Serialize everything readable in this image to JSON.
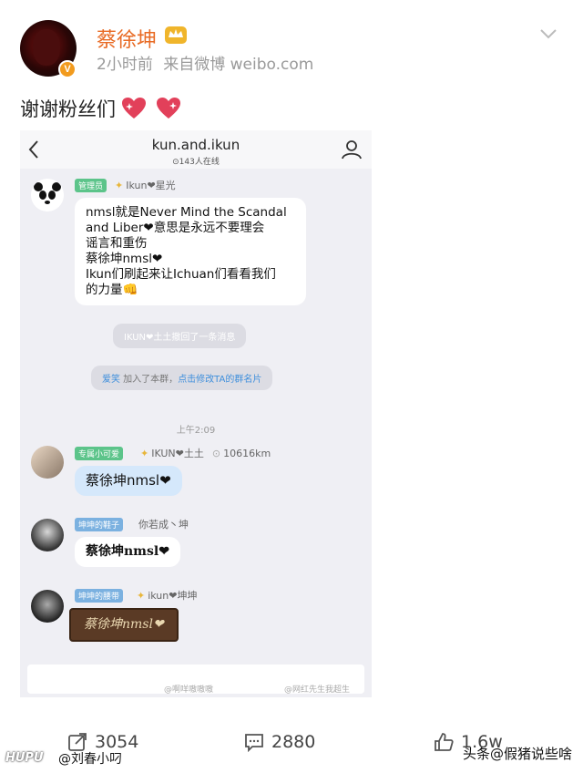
{
  "post": {
    "username": "蔡徐坤",
    "time": "2小时前",
    "source": "来自微博 weibo.com",
    "text": "谢谢粉丝们",
    "verified_badge": "V"
  },
  "screenshot": {
    "group_title": "kun.and.ikun",
    "online": "⊙143人在线",
    "messages": [
      {
        "tag": "管理员",
        "tag_color": "#5cc48a",
        "sender": "Ikun❤星光",
        "lines": [
          "nmsl就是Never Mind the Scandal",
          "and Liber❤意思是永远不要理会",
          "谣言和重伤",
          "蔡徐坤nmsl❤",
          "Ikun们刷起来让Ichuan们看看我们",
          "的力量👊"
        ]
      },
      {
        "system1": "IKUN❤土土撤回了一条消息"
      },
      {
        "system2_name": "爱笑",
        "system2_mid": " 加入了本群，",
        "system2_link": "点击修改TA的群名片"
      },
      {
        "time": "上午2:09"
      },
      {
        "tag": "专属小可爱",
        "tag_color": "#5cc48a",
        "sender": "IKUN❤土土",
        "distance": "10616km",
        "text": "蔡徐坤nmsl❤"
      },
      {
        "tag": "坤坤的鞋子",
        "tag_color": "#7bb1e0",
        "sender": "你若成丶坤",
        "text": "蔡徐坤nmsl❤"
      },
      {
        "tag": "坤坤的腰带",
        "tag_color": "#7bb1e0",
        "sender": "ikun❤坤坤",
        "text": "蔡徐坤nmsl❤"
      }
    ],
    "watermark_left": "@啊咩嗷嗷嗷",
    "watermark_right": "@网红先生我超生"
  },
  "footer": {
    "reposts": "3054",
    "comments": "2880",
    "likes": "1.6w"
  },
  "overlay": {
    "hupu": "HUPU",
    "credit": "@刘春小叼",
    "toutiao": "头条@假猪说些啥"
  },
  "colors": {
    "username": "#e86a23",
    "accent": "#f29b1e"
  }
}
